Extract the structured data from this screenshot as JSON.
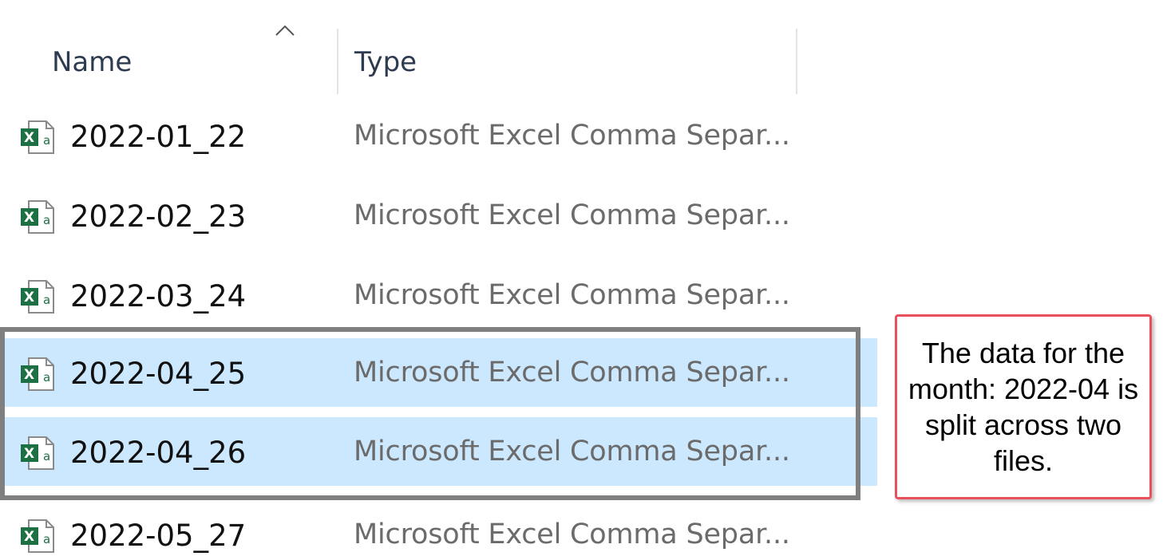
{
  "header": {
    "sort_icon": "chevron-up-icon",
    "columns": [
      {
        "label": "Name"
      },
      {
        "label": "Type"
      }
    ]
  },
  "files": [
    {
      "name": "2022-01_22",
      "type": "Microsoft Excel Comma Separ...",
      "selected": false,
      "icon": "excel-csv-file-icon"
    },
    {
      "name": "2022-02_23",
      "type": "Microsoft Excel Comma Separ...",
      "selected": false,
      "icon": "excel-csv-file-icon"
    },
    {
      "name": "2022-03_24",
      "type": "Microsoft Excel Comma Separ...",
      "selected": false,
      "icon": "excel-csv-file-icon"
    },
    {
      "name": "2022-04_25",
      "type": "Microsoft Excel Comma Separ...",
      "selected": true,
      "icon": "excel-csv-file-icon"
    },
    {
      "name": "2022-04_26",
      "type": "Microsoft Excel Comma Separ...",
      "selected": true,
      "icon": "excel-csv-file-icon"
    },
    {
      "name": "2022-05_27",
      "type": "Microsoft Excel Comma Separ...",
      "selected": false,
      "icon": "excel-csv-file-icon"
    }
  ],
  "callout": {
    "text": "The data for the month: 2022-04 is split across two files.",
    "border_color": "#e8505b"
  },
  "colors": {
    "selected_row": "#cce8ff",
    "selection_frame": "#7f7f7f",
    "excel_green": "#1d7044"
  }
}
